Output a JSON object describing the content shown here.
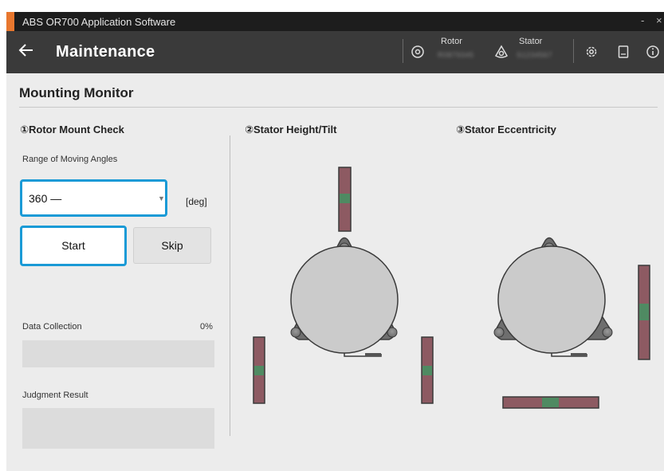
{
  "app": {
    "title": "ABS OR700 Application Software",
    "minimize_glyph": "-",
    "close_glyph": "×",
    "accent_color": "#e8772e"
  },
  "header": {
    "back_icon": "arrow-left-icon",
    "title": "Maintenance",
    "rotor_label": "Rotor",
    "rotor_value": "R0879345",
    "stator_label": "Stator",
    "stator_value": "S1234567",
    "icons": [
      "rotor-icon",
      "stator-icon",
      "settings-icon",
      "document-icon",
      "info-icon"
    ]
  },
  "page": {
    "section_title": "Mounting Monitor"
  },
  "rotor_check": {
    "title": "①Rotor Mount Check",
    "range_label": "Range of Moving Angles",
    "range_value": "360 —",
    "unit": "[deg]",
    "start_label": "Start",
    "skip_label": "Skip",
    "data_collection_label": "Data Collection",
    "data_collection_percent": "0%",
    "data_collection_progress": 0,
    "judgment_label": "Judgment Result",
    "focus_color": "#1a9ad6"
  },
  "stator_height": {
    "title": "②Stator Height/Tilt"
  },
  "stator_eccentricity": {
    "title": "③Stator Eccentricity"
  },
  "gauge_colors": {
    "bar": "#8d5a62",
    "ok_zone": "#4f8a62",
    "frame": "#3a3a3a"
  }
}
